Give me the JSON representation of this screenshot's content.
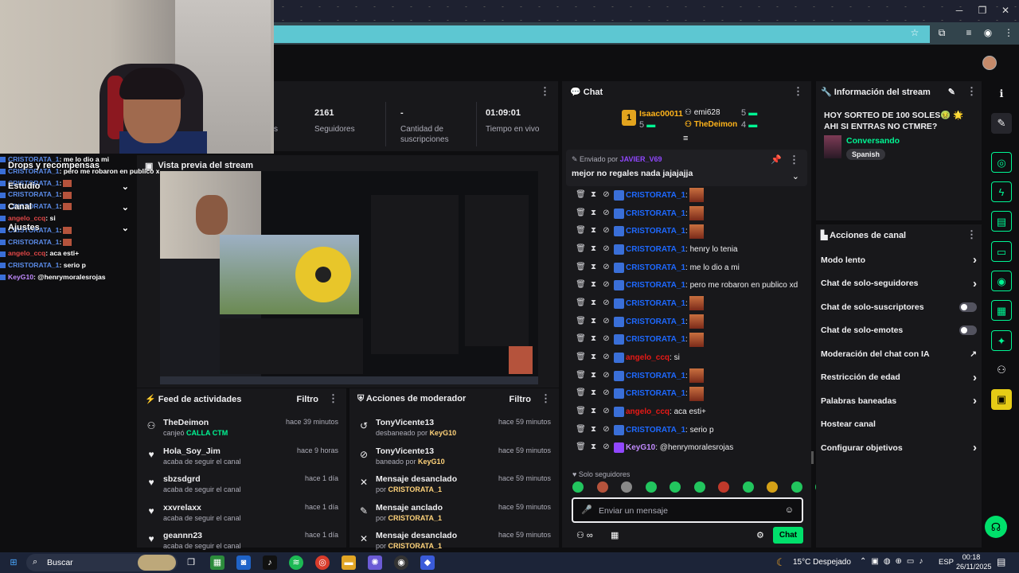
{
  "overlay": {
    "chat": [
      {
        "user": "KeyG10",
        "text": ": @henrymoralesrojas",
        "color": "k"
      },
      {
        "user": "CRISTORATA_1",
        "text": ": serio p",
        "color": "u"
      },
      {
        "user": "angelo_ccq",
        "text": ": aca esti+",
        "color": "r"
      },
      {
        "user": "CRISTORATA_1",
        "text": ":",
        "color": "u",
        "emote": true
      },
      {
        "user": "CRISTORATA_1",
        "text": ":",
        "color": "u",
        "emote": true
      },
      {
        "user": "angelo_ccq",
        "text": ": si",
        "color": "r"
      },
      {
        "user": "CRISTORATA_1",
        "text": ":",
        "color": "u",
        "emote": true
      },
      {
        "user": "CRISTORATA_1",
        "text": ":",
        "color": "u",
        "emote": true
      },
      {
        "user": "CRISTORATA_1",
        "text": ":",
        "color": "u",
        "emote": true
      },
      {
        "user": "CRISTORATA_1",
        "text": ": pero me robaron en publico xd",
        "color": "u"
      },
      {
        "user": "CRISTORATA_1",
        "text": ": me lo dio a mi",
        "color": "u"
      }
    ],
    "menu": [
      "Drops y recompensas",
      "Estudio",
      "Canal",
      "Ajustes"
    ]
  },
  "stats": {
    "followers_value": "2161",
    "followers_label": "Seguidores",
    "subs_value": "-",
    "subs_label": "Cantidad de suscripciones",
    "time_value": "01:09:01",
    "time_label": "Tiempo en vivo",
    "partial_label": "s"
  },
  "preview": {
    "title": "Vista previa del stream"
  },
  "feed": {
    "title": "Feed de actividades",
    "filter": "Filtro",
    "rows": [
      {
        "name": "TheDeimon",
        "sub_prefix": "canjeó ",
        "sub_hl": "CALLA CTM",
        "time": "hace 39 minutos",
        "icon": "⚇"
      },
      {
        "name": "Hola_Soy_Jim",
        "sub_prefix": "acaba de seguir el canal",
        "sub_hl": "",
        "time": "hace 9 horas",
        "icon": "♥"
      },
      {
        "name": "sbzsdgrd",
        "sub_prefix": "acaba de seguir el canal",
        "sub_hl": "",
        "time": "hace 1 día",
        "icon": "♥"
      },
      {
        "name": "xxvrelaxx",
        "sub_prefix": "acaba de seguir el canal",
        "sub_hl": "",
        "time": "hace 1 día",
        "icon": "♥"
      },
      {
        "name": "geannn23",
        "sub_prefix": "acaba de seguir el canal",
        "sub_hl": "",
        "time": "hace 1 día",
        "icon": "♥"
      }
    ]
  },
  "mod": {
    "title": "Acciones de moderador",
    "filter": "Filtro",
    "rows": [
      {
        "name": "TonyVicente13",
        "sub_prefix": "desbaneado por ",
        "sub_hl": "KeyG10",
        "time": "hace 59 minutos",
        "icon": "↺"
      },
      {
        "name": "TonyVicente13",
        "sub_prefix": "baneado por ",
        "sub_hl": "KeyG10",
        "time": "hace 59 minutos",
        "icon": "⊘"
      },
      {
        "name": "Mensaje desanclado",
        "sub_prefix": "por ",
        "sub_hl": "CRISTORATA_1",
        "time": "hace 59 minutos",
        "icon": "✕"
      },
      {
        "name": "Mensaje anclado",
        "sub_prefix": "por ",
        "sub_hl": "CRISTORATA_1",
        "time": "hace 59 minutos",
        "icon": "✎"
      },
      {
        "name": "Mensaje desanclado",
        "sub_prefix": "por ",
        "sub_hl": "CRISTORATA_1",
        "time": "hace 59 minutos",
        "icon": "✕"
      }
    ]
  },
  "chat": {
    "title": "Chat",
    "leader": {
      "first_name": "Isaac00011",
      "first_count": "5",
      "rank": "1",
      "second_name": "emi628",
      "second_count": "5",
      "third_name": "TheDeimon",
      "third_count": "4"
    },
    "pinned": {
      "sent_by_label": "Enviado por",
      "sent_by_user": "JAVIER_V69",
      "text": "mejor no regales nada jajajajja"
    },
    "messages": [
      {
        "user": "CRISTORATA_1",
        "text": ":",
        "emote": true,
        "color": "nm"
      },
      {
        "user": "CRISTORATA_1",
        "text": ":",
        "emote": true,
        "color": "nm"
      },
      {
        "user": "CRISTORATA_1",
        "text": ":",
        "emote": true,
        "color": "nm"
      },
      {
        "user": "CRISTORATA_1",
        "text": ": henry lo tenia",
        "emote": false,
        "color": "nm"
      },
      {
        "user": "CRISTORATA_1",
        "text": ": me lo dio a mi",
        "emote": false,
        "color": "nm"
      },
      {
        "user": "CRISTORATA_1",
        "text": ": pero me robaron en publico xd",
        "emote": false,
        "color": "nm"
      },
      {
        "user": "CRISTORATA_1",
        "text": ":",
        "emote": true,
        "color": "nm"
      },
      {
        "user": "CRISTORATA_1",
        "text": ":",
        "emote": true,
        "color": "nm"
      },
      {
        "user": "CRISTORATA_1",
        "text": ":",
        "emote": true,
        "color": "nm"
      },
      {
        "user": "angelo_ccq",
        "text": ": si",
        "emote": false,
        "color": "nr"
      },
      {
        "user": "CRISTORATA_1",
        "text": ":",
        "emote": true,
        "color": "nm"
      },
      {
        "user": "CRISTORATA_1",
        "text": ":",
        "emote": true,
        "color": "nm"
      },
      {
        "user": "angelo_ccq",
        "text": ": aca esti+",
        "emote": false,
        "color": "nr"
      },
      {
        "user": "CRISTORATA_1",
        "text": ": serio p",
        "emote": false,
        "color": "nm"
      },
      {
        "user": "KeyG10",
        "text": ": @henrymoralesrojas",
        "emote": false,
        "color": "nk"
      }
    ],
    "mode_label": "Solo seguidores",
    "input_placeholder": "Enviar un mensaje",
    "send_label": "Chat"
  },
  "info": {
    "title": "Información del stream",
    "stream_title": "HOY SORTEO DE 100 SOLES🤢 🌟 AHI SI ENTRAS NO CTMRE?",
    "category": "Conversando",
    "tag": "Spanish"
  },
  "actions": {
    "title": "Acciones de canal",
    "items": [
      {
        "label": "Modo lento",
        "control": "chevron"
      },
      {
        "label": "Chat de solo-seguidores",
        "control": "chevron"
      },
      {
        "label": "Chat de solo-suscriptores",
        "control": "toggle"
      },
      {
        "label": "Chat de solo-emotes",
        "control": "toggle"
      },
      {
        "label": "Moderación del chat con IA",
        "control": "external"
      },
      {
        "label": "Restricción de edad",
        "control": "chevron"
      },
      {
        "label": "Palabras baneadas",
        "control": "chevron"
      },
      {
        "label": "Hostear canal",
        "control": "none"
      },
      {
        "label": "Configurar objetivos",
        "control": "chevron"
      }
    ]
  },
  "taskbar": {
    "search": "Buscar",
    "weather": "15°C Despejado",
    "lang": "ESP",
    "time": "00:18",
    "date": "26/11/2025"
  },
  "colors": {
    "accent": "#00f593",
    "purple": "#9147ff",
    "bg": "#18181b"
  }
}
